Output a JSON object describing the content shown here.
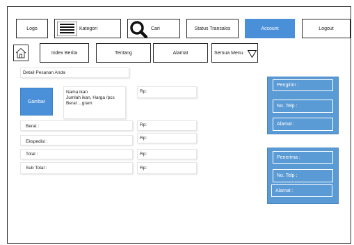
{
  "nav": {
    "logo": "Logo",
    "kategori": "Kategori",
    "cari": "Cari",
    "status_transaksi": "Status Transaksi",
    "account": "Account",
    "logout": "Logout"
  },
  "subnav": {
    "index_berita": "Index Berita",
    "tentang": "Tentang",
    "alamat": "Alamat",
    "semua_menu": "Semua Menu"
  },
  "order": {
    "title": "Detail Pesanan Anda",
    "gambar": "Gambar",
    "item_name": "Nama ikan",
    "item_detail": "Jumlah ikan, Harga /pcs",
    "item_weight": "Berat ...gram",
    "price_label": "Rp:",
    "rows": [
      {
        "label": "Berat :",
        "value": "Rp:"
      },
      {
        "label": "Ekspedisi :",
        "value": "Rp:"
      },
      {
        "label": "Total :",
        "value": "Rp:"
      },
      {
        "label": "Sub Total :",
        "value": "Rp:"
      }
    ]
  },
  "sender": {
    "pengirim": "Pengirim :",
    "no_telp": "No. Telp :",
    "alamat": "Alamat :"
  },
  "receiver": {
    "penerima": "Penerima :",
    "no_telp": "No. Telp :",
    "alamat": "Alamat :"
  },
  "colors": {
    "accent": "#4a90d9",
    "panel": "#5b9bd5"
  }
}
